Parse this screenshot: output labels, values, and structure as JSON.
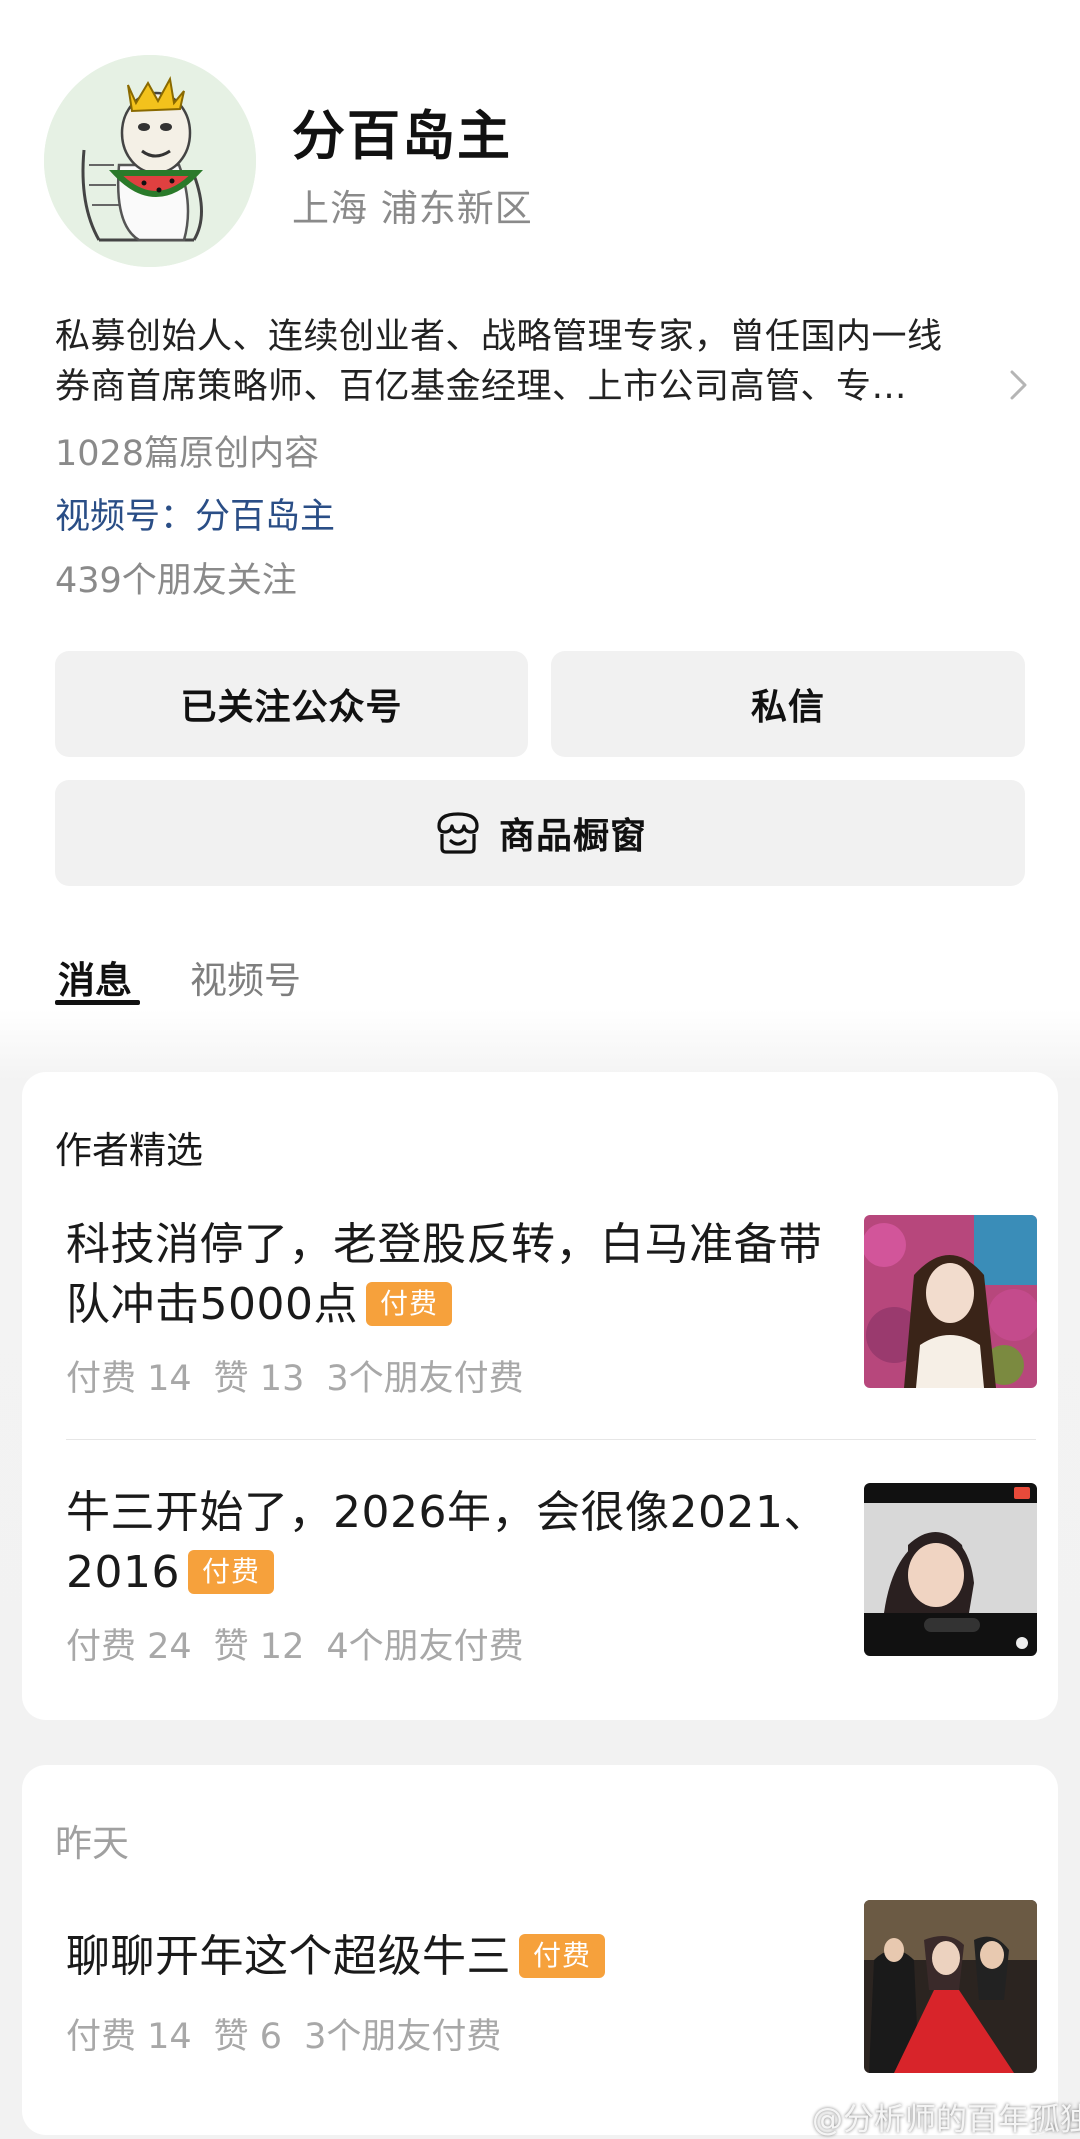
{
  "profile": {
    "name": "分百岛主",
    "location": "上海 浦东新区",
    "bio_line1": "私募创始人、连续创业者、战略管理专家，曾任国内一线",
    "bio_line2": "券商首席策略师、百亿基金经理、上市公司高管、专…",
    "original_count": "1028篇原创内容",
    "channel": "视频号：分百岛主",
    "friends_following": "439个朋友关注"
  },
  "actions": {
    "follow_label": "已关注公众号",
    "message_label": "私信",
    "shop_label": "商品橱窗"
  },
  "tabs": [
    {
      "label": "消息",
      "active": true
    },
    {
      "label": "视频号",
      "active": false
    }
  ],
  "featured": {
    "title": "作者精选",
    "articles": [
      {
        "title": "科技消停了，老登股反转，白马准备带队冲击5000点",
        "badge": "付费",
        "paid": "付费 14",
        "likes": "赞 13",
        "friends_paid": "3个朋友付费"
      },
      {
        "title": "牛三开始了，2026年，会很像2021、2016",
        "badge": "付费",
        "paid": "付费 24",
        "likes": "赞 12",
        "friends_paid": "4个朋友付费"
      }
    ]
  },
  "yesterday": {
    "title": "昨天",
    "articles": [
      {
        "title": "聊聊开年这个超级牛三",
        "badge": "付费",
        "paid": "付费 14",
        "likes": "赞 6",
        "friends_paid": "3个朋友付费"
      }
    ]
  },
  "watermark": "@分析师的百年孤独",
  "colors": {
    "badge": "#f6a13c",
    "link": "#2a4e86",
    "button_bg": "#f1f1f1"
  }
}
